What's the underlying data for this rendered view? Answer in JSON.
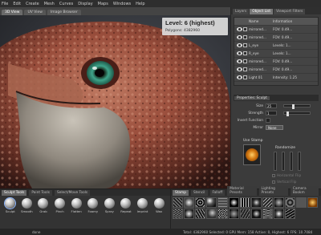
{
  "app": {
    "name": "Mudbox"
  },
  "menu": [
    "File",
    "Edit",
    "Create",
    "Mesh",
    "Curves",
    "Display",
    "Maps",
    "Windows",
    "Help"
  ],
  "view_tabs": [
    {
      "label": "3D View",
      "active": true
    },
    {
      "label": "UV View",
      "active": false
    },
    {
      "label": "Image Browser",
      "active": false
    }
  ],
  "hud": {
    "level": "Level: 6 (highest)",
    "polygons": "Polygons: 4382960"
  },
  "right_tabs": [
    {
      "label": "Layers",
      "active": false
    },
    {
      "label": "Object List",
      "active": true
    },
    {
      "label": "Viewport Filters",
      "active": false
    }
  ],
  "layers": {
    "columns": [
      "",
      "Name",
      "Information"
    ],
    "rows": [
      {
        "name": "Name",
        "info": "Information",
        "visible": true
      },
      {
        "name": "mirrored...",
        "info": "FOV: 0.49...",
        "visible": true
      },
      {
        "name": "mirrored...",
        "info": "FOV: 0.49...",
        "visible": true
      },
      {
        "name": "L_eye",
        "info": "Levels: 1...",
        "visible": true
      },
      {
        "name": "R_eye",
        "info": "Levels: 1...",
        "visible": true
      },
      {
        "name": "mirrored...",
        "info": "FOV: 0.49...",
        "visible": true
      },
      {
        "name": "mirrored...",
        "info": "FOV: 0.49...",
        "visible": true
      },
      {
        "name": "Light 01",
        "info": "Intensity: 1.25",
        "visible": true
      }
    ]
  },
  "properties": {
    "tabs": [
      "Properties: Sculpt"
    ],
    "rows": [
      {
        "label": "Size",
        "value": "25",
        "slider": 0.3
      },
      {
        "label": "Strength",
        "value": "1",
        "slider": 0.1
      },
      {
        "label": "Invert Function",
        "value": "",
        "slider": null
      },
      {
        "label": "Mirror",
        "select": "None"
      }
    ],
    "use_stamp_label": "Use Stamp",
    "randomize_label": "Randomize",
    "horizontal_flip": "Horizontal Flip",
    "vertical_flip": "Vertical Flip"
  },
  "tool_tabs": [
    {
      "label": "Sculpt Tools",
      "active": true
    },
    {
      "label": "Paint Tools",
      "active": false
    },
    {
      "label": "Select/Move Tools",
      "active": false
    }
  ],
  "tools": [
    {
      "label": "Sculpt",
      "active": true
    },
    {
      "label": "Smooth"
    },
    {
      "label": "Grab"
    },
    {
      "label": "Pinch"
    },
    {
      "label": "Flatten"
    },
    {
      "label": "Foamy"
    },
    {
      "label": "Spray"
    },
    {
      "label": "Repeat"
    },
    {
      "label": "Imprint"
    },
    {
      "label": "Wax"
    }
  ],
  "tray_tabs": [
    {
      "label": "Stamp",
      "active": true
    },
    {
      "label": "Stencil",
      "active": false
    },
    {
      "label": "Falloff",
      "active": false
    },
    {
      "label": "Material Presets",
      "active": false
    },
    {
      "label": "Lighting Presets",
      "active": false
    },
    {
      "label": "Camera Bookm",
      "active": false
    }
  ],
  "status": {
    "done": "done",
    "totals": "Total: 4382960  Selected: 0  GPU Mem: 158  Active: 0, Highest: 6  FPS: 10.7084"
  }
}
